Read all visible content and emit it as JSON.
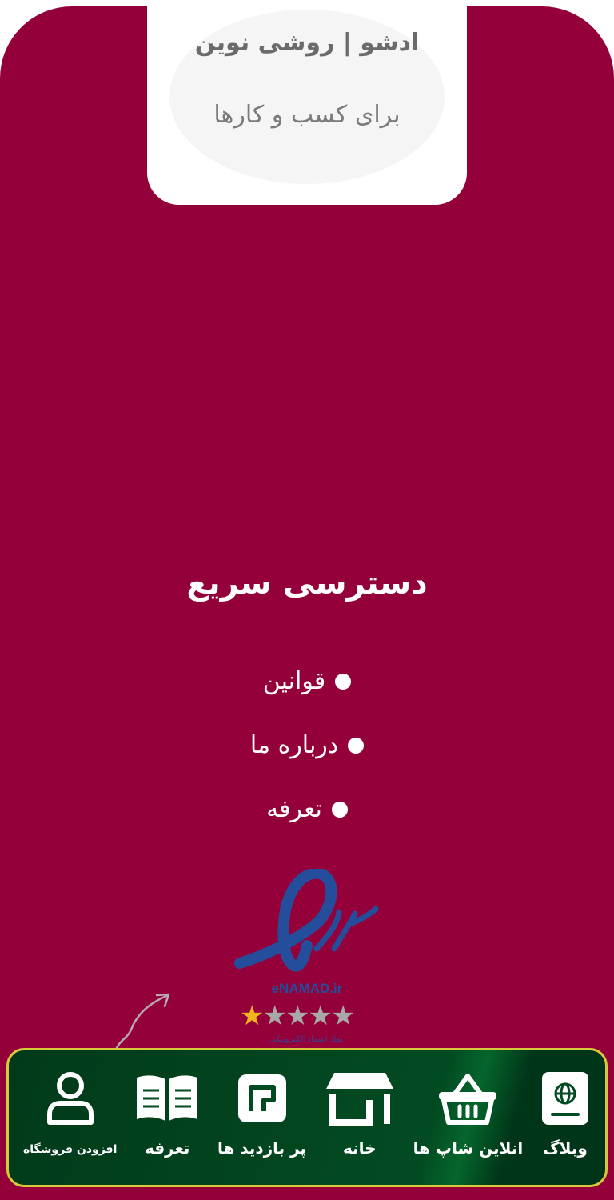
{
  "brand": {
    "title": "ادشو | روشی نوین",
    "subtitle": "برای کسب و کارها"
  },
  "quick_access": {
    "title": "دسترسی سریع",
    "links": [
      {
        "label": "قوانین"
      },
      {
        "label": "درباره ما"
      },
      {
        "label": "تعرفه"
      }
    ]
  },
  "trust_badge": {
    "site": "eNAMAD.ir",
    "stars_filled": 1,
    "stars_total": 5,
    "caption": "نماد اعتماد الکترونیکی"
  },
  "bottom_nav": {
    "items": [
      {
        "label": "وبلاگ",
        "icon": "globe-book-icon"
      },
      {
        "label": "انلاین شاپ ها",
        "icon": "basket-icon"
      },
      {
        "label": "خانه",
        "icon": "store-icon"
      },
      {
        "label": "پر بازدید ها",
        "icon": "tiles-icon"
      },
      {
        "label": "تعرفه",
        "icon": "open-book-icon"
      },
      {
        "label": "افزودن فروشگاه",
        "icon": "user-icon"
      }
    ]
  },
  "colors": {
    "footer_bg": "#93003a",
    "nav_bg": "#024b22",
    "nav_border": "#d8c93a",
    "enamad_blue": "#244e9c",
    "star_gold": "#f3b51f"
  }
}
